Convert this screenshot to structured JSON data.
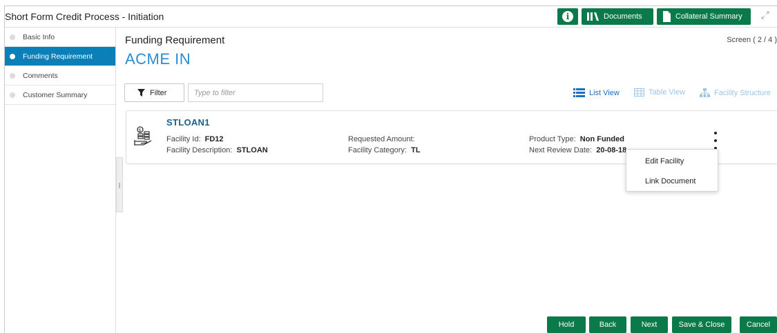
{
  "app": {
    "title": "Short Form Credit Process - Initiation"
  },
  "toolbar": {
    "documents_label": "Documents",
    "collateral_label": "Collateral Summary"
  },
  "sidebar": {
    "steps": [
      {
        "label": "Basic Info",
        "active": false
      },
      {
        "label": "Funding Requirement",
        "active": true
      },
      {
        "label": "Comments",
        "active": false
      },
      {
        "label": "Customer Summary",
        "active": false
      }
    ]
  },
  "main": {
    "page_title": "Funding Requirement",
    "entity_name": "ACME IN",
    "screen_indicator": "Screen ( 2 / 4 )",
    "filter_label": "Filter",
    "filter_placeholder": "Type to filter",
    "views": {
      "list": "List View",
      "table": "Table View",
      "structure": "Facility Structure"
    }
  },
  "facility": {
    "name": "STLOAN1",
    "facility_id_label": "Facility Id:",
    "facility_id": "FD12",
    "description_label": "Facility Description:",
    "description": "STLOAN",
    "requested_amount_label": "Requested Amount:",
    "requested_amount": "",
    "category_label": "Facility Category:",
    "category": "TL",
    "product_type_label": "Product Type:",
    "product_type": "Non Funded",
    "review_date_label": "Next Review Date:",
    "review_date": "20-08-18"
  },
  "context_menu": {
    "items": [
      "Edit Facility",
      "Link Document"
    ]
  },
  "footer": {
    "hold": "Hold",
    "back": "Back",
    "next": "Next",
    "save_close": "Save & Close",
    "cancel": "Cancel"
  },
  "colors": {
    "primary_green": "#0a7a4a",
    "active_blue": "#0a7fb8",
    "link_blue": "#2b8ccf"
  }
}
